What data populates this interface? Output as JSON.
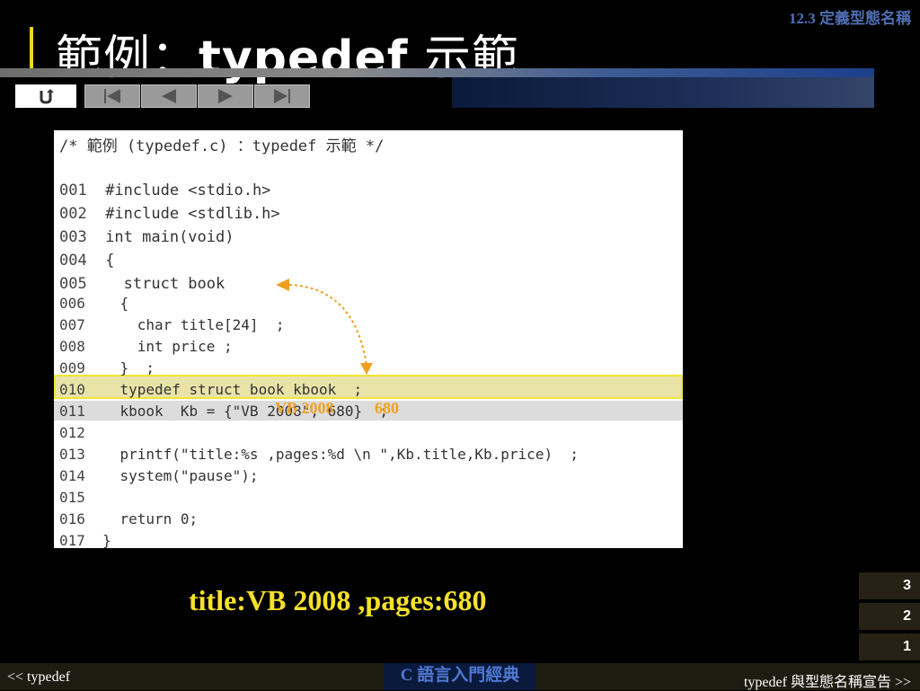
{
  "header": {
    "section_label": "12.3 定義型態名稱",
    "title_prefix": "範例：",
    "title_code": "typedef",
    "title_suffix": " 示範"
  },
  "nav": {
    "buttons": [
      "home-return",
      "first",
      "previous",
      "next",
      "last"
    ]
  },
  "code": {
    "comment": "/* 範例 (typedef.c) ：typedef 示範 */",
    "lines": [
      {
        "num": "001",
        "text": "  #include <stdio.h>"
      },
      {
        "num": "002",
        "text": "  #include <stdlib.h>"
      },
      {
        "num": "003",
        "text": "  int main(void)"
      },
      {
        "num": "004",
        "text": "  {"
      },
      {
        "num": "005",
        "text": "    struct book"
      },
      {
        "num": "006",
        "text": "    {"
      },
      {
        "num": "007",
        "text": "      char title[24]  ;"
      },
      {
        "num": "008",
        "text": "      int price ;"
      },
      {
        "num": "009",
        "text": "    }  ;"
      },
      {
        "num": "010",
        "text": "    typedef struct book kbook  ;"
      },
      {
        "num": "011",
        "text": "    kbook  Kb = {\"VB 2008\", 680}  ;"
      },
      {
        "num": "012",
        "text": ""
      },
      {
        "num": "013",
        "text": "    printf(\"title:%s ,pages:%d \\n \",Kb.title,Kb.price)  ;"
      },
      {
        "num": "014",
        "text": "    system(\"pause\");"
      },
      {
        "num": "015",
        "text": ""
      },
      {
        "num": "016",
        "text": "    return 0;"
      },
      {
        "num": "017",
        "text": "  }"
      }
    ],
    "overlay_title": "VB 2008",
    "overlay_price": "680"
  },
  "output": {
    "text": "title:VB 2008 ,pages:680"
  },
  "pages": [
    "3",
    "2",
    "1"
  ],
  "footer": {
    "prev": "<< typedef",
    "center": "C 語言入門經典",
    "next": "typedef 與型態名稱宣告 >>"
  },
  "colors": {
    "accent_yellow": "#f5e12a",
    "highlight_orange": "#f0a020",
    "blue_label": "#4f6fb5"
  }
}
